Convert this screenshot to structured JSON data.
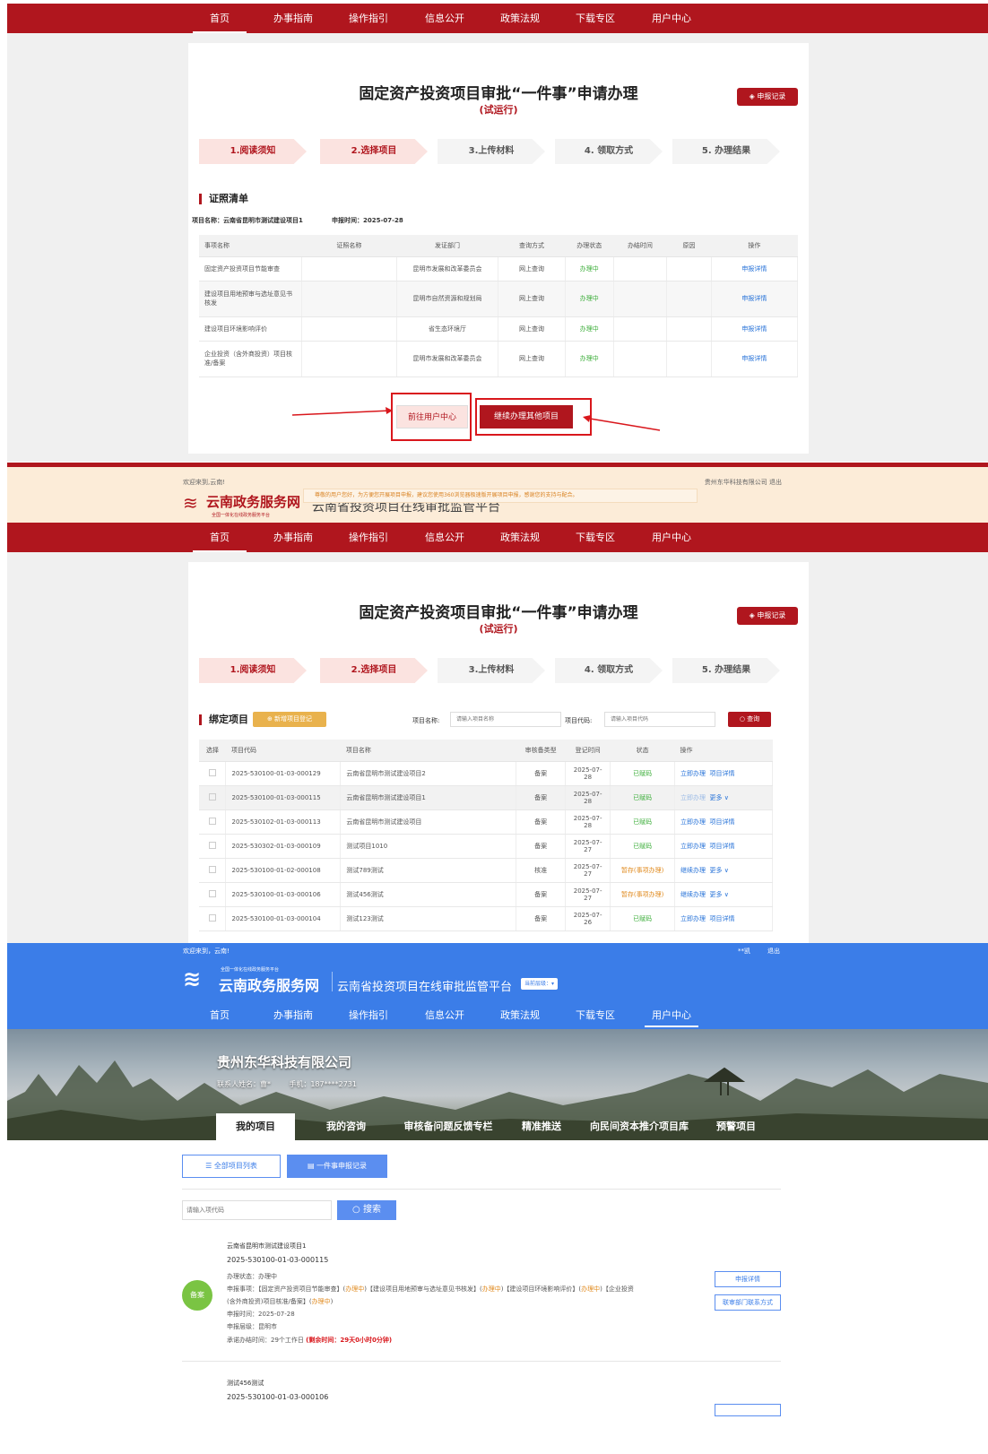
{
  "nav": [
    "首页",
    "办事指南",
    "操作指引",
    "信息公开",
    "政策法规",
    "下载专区",
    "用户中心"
  ],
  "page": {
    "title": "固定资产投资项目审批“一件事”申请办理",
    "subtitle": "(试运行)",
    "record_btn": "申报记录",
    "steps": [
      "1.阅读须知",
      "2.选择项目",
      "3.上传材料",
      "4. 领取方式",
      "5. 办理结果"
    ]
  },
  "cert": {
    "section": "证照清单",
    "project_label": "项目名称：云南省昆明市测试建设项目1",
    "date_label": "申报时间：2025-07-28",
    "headers": [
      "事项名称",
      "证照名称",
      "发证部门",
      "查询方式",
      "办理状态",
      "办结时间",
      "原因",
      "操作"
    ],
    "rows": [
      {
        "name": "固定资产投资项目节能审查",
        "cert": "",
        "dept": "昆明市发展和改革委员会",
        "query": "网上查询",
        "status": "办理中",
        "done": "",
        "reason": "",
        "op": "申报详情"
      },
      {
        "name": "建设项目用地预审与选址意见书核发",
        "cert": "",
        "dept": "昆明市自然资源和规划局",
        "query": "网上查询",
        "status": "办理中",
        "done": "",
        "reason": "",
        "op": "申报详情"
      },
      {
        "name": "建设项目环境影响评价",
        "cert": "",
        "dept": "省生态环境厅",
        "query": "网上查询",
        "status": "办理中",
        "done": "",
        "reason": "",
        "op": "申报详情"
      },
      {
        "name": "企业投资（含外商投资）项目核准/备案",
        "cert": "",
        "dept": "昆明市发展和改革委员会",
        "query": "网上查询",
        "status": "办理中",
        "done": "",
        "reason": "",
        "op": "申报详情"
      }
    ],
    "btn_user_center": "前往用户中心",
    "btn_continue": "继续办理其他项目"
  },
  "strip": {
    "welcome": "欢迎来到,云南!",
    "company_logout": "贵州东华科技有限公司  退出",
    "notice": "尊敬的用户您好，为方便您开展项目申报，建议您使用360浏览器极速版开展项目申报，感谢您的支持与配合。",
    "logo": "云南政务服务网",
    "logo_sub": "全国一体化在线政务服务平台",
    "platform_partial": "云南省投资项目在线审批监管平台"
  },
  "bind": {
    "section": "绑定项目",
    "add_btn": "新增项目登记",
    "name_label": "项目名称:",
    "name_placeholder": "请输入项目名称",
    "code_label": "项目代码:",
    "code_placeholder": "请输入项目代码",
    "query_btn": "查询",
    "headers": [
      "选择",
      "项目代码",
      "项目名称",
      "审核备类型",
      "登记时间",
      "状态",
      "操作"
    ],
    "rows": [
      {
        "code": "2025-530100-01-03-000129",
        "name": "云南省昆明市测试建设项目2",
        "type": "备案",
        "date": "2025-07-28",
        "status": "已赋码",
        "op1": "立即办理",
        "op2": "项目详情"
      },
      {
        "code": "2025-530100-01-03-000115",
        "name": "云南省昆明市测试建设项目1",
        "type": "备案",
        "date": "2025-07-28",
        "status": "已赋码",
        "op1": "立即办理",
        "op2": "更多 ∨"
      },
      {
        "code": "2025-530102-01-03-000113",
        "name": "云南省昆明市测试建设项目",
        "type": "备案",
        "date": "2025-07-28",
        "status": "已赋码",
        "op1": "立即办理",
        "op2": "项目详情"
      },
      {
        "code": "2025-530302-01-03-000109",
        "name": "测试项目1010",
        "type": "备案",
        "date": "2025-07-27",
        "status": "已赋码",
        "op1": "立即办理",
        "op2": "项目详情"
      },
      {
        "code": "2025-530100-01-02-000108",
        "name": "测试789测试",
        "type": "核准",
        "date": "2025-07-27",
        "status": "暂存(事项办理)",
        "op1": "继续办理",
        "op2": "更多 ∨"
      },
      {
        "code": "2025-530100-01-03-000106",
        "name": "测试456测试",
        "type": "备案",
        "date": "2025-07-27",
        "status": "暂存(事项办理)",
        "op1": "继续办理",
        "op2": "更多 ∨"
      },
      {
        "code": "2025-530100-01-03-000104",
        "name": "测试123测试",
        "type": "备案",
        "date": "2025-07-26",
        "status": "已赋码",
        "op1": "立即办理",
        "op2": "项目详情"
      }
    ]
  },
  "user": {
    "welcome": "欢迎来到，云南!",
    "user_short": "**凯",
    "logout": "退出",
    "logo": "云南政务服务网",
    "logo_sub": "全国一体化在线政务服务平台",
    "platform": "云南省投资项目在线审批监管平台",
    "level_btn": "当前层级：",
    "company": "贵州东华科技有限公司",
    "contact": "联系人姓名：曹*        手机：187****2731",
    "tabs": [
      "我的项目",
      "我的咨询",
      "审核备问题反馈专栏",
      "精准推送",
      "向民间资本推介项目库",
      "预警项目"
    ],
    "btn_all": "全部项目列表",
    "btn_onething": "一件事申报记录",
    "search_placeholder": "请输入项代码",
    "search_btn": "搜索",
    "badge": "备案",
    "p1": {
      "name": "云南省昆明市测试建设项目1",
      "code": "2025-530100-01-03-000115",
      "state": "办理状态：办理中",
      "items_a": "申报事项：【固定资产投资项目节能审查】(",
      "s1": "办理中",
      "items_b": ")【建设项目用地预审与选址意见书核发】(",
      "s2": "办理中",
      "items_c": ")【建设项目环境影响评价】(",
      "s3": "办理中",
      "items_d": ")【企业投资",
      "items_e": "(含外商投资)项目核准/备案】(",
      "s4": "办理中",
      "items_f": ")",
      "date": "申报时间：2025-07-28",
      "level": "申报层级：昆明市",
      "promise_a": "承诺办结时间：29个工作日 ",
      "promise_b": "(剩余时间：29天0小时0分钟)",
      "btn_detail": "申报详情",
      "btn_contact": "联审部门联系方式"
    },
    "p2": {
      "name": "测试456测试",
      "code": "2025-530100-01-03-000106"
    }
  }
}
